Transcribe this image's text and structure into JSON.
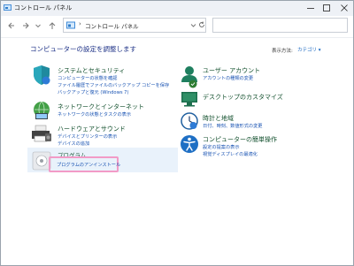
{
  "window": {
    "title": "コントロール パネル",
    "search_placeholder": ""
  },
  "address": {
    "separator": "›",
    "crumb": "コントロール パネル"
  },
  "page": {
    "title": "コンピューターの設定を調整します",
    "view_label": "表示方法:",
    "view_value": "カテゴリ ▾"
  },
  "categories": {
    "system": {
      "title": "システムとセキュリティ",
      "links": [
        "コンピューターの状態を確認",
        "ファイル履歴でファイルのバックアップ コピーを保存",
        "バックアップと復元 (Windows 7)"
      ]
    },
    "network": {
      "title": "ネットワークとインターネット",
      "links": [
        "ネットワークの状態とタスクの表示"
      ]
    },
    "hardware": {
      "title": "ハードウェアとサウンド",
      "links": [
        "デバイスとプリンターの表示",
        "デバイスの追加"
      ]
    },
    "programs": {
      "title": "プログラム",
      "links": [
        "プログラムのアンインストール"
      ]
    },
    "accounts": {
      "title": "ユーザー アカウント",
      "links": [
        "アカウントの種類の変更"
      ]
    },
    "desktop": {
      "title": "デスクトップのカスタマイズ",
      "links": []
    },
    "clock": {
      "title": "時計と地域",
      "links": [
        "日付、時刻、数値形式の変更"
      ]
    },
    "ease": {
      "title": "コンピューターの簡単操作",
      "links": [
        "設定の提案の表示",
        "視覚ディスプレイの最適化"
      ]
    }
  }
}
